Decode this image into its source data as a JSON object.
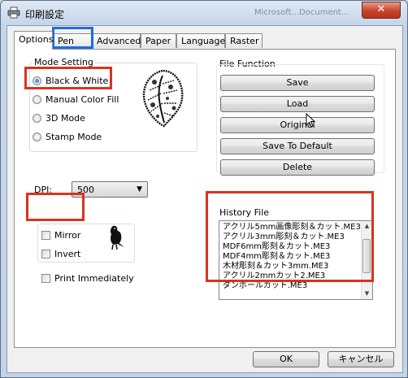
{
  "window": {
    "title": "印刷設定",
    "title_ghost": "Microsoft...Document...",
    "close_label": "✕"
  },
  "tabs": [
    {
      "label": "Options",
      "active": true
    },
    {
      "label": "Pen"
    },
    {
      "label": "Advanced"
    },
    {
      "label": "Paper"
    },
    {
      "label": "Language"
    },
    {
      "label": "Raster"
    }
  ],
  "mode": {
    "legend": "Mode Setting",
    "options": [
      {
        "label": "Black & White",
        "selected": true
      },
      {
        "label": "Manual Color Fill"
      },
      {
        "label": "3D Mode"
      },
      {
        "label": "Stamp Mode"
      }
    ]
  },
  "dpi": {
    "label": "DPI:",
    "value": "500"
  },
  "effects": {
    "mirror": "Mirror",
    "invert": "Invert",
    "print_immediately": "Print Immediately"
  },
  "file_function": {
    "legend": "File Function",
    "buttons": [
      "Save",
      "Load",
      "Original",
      "Save To Default",
      "Delete"
    ]
  },
  "history": {
    "legend": "History File",
    "items": [
      "アクリル5mm画像彫刻＆カット.ME3",
      "アクリル3mm彫刻＆カット.ME3",
      "MDF6mm彫刻＆カット.ME3",
      "MDF4mm彫刻＆カット.ME3",
      "木材彫刻＆カット3mm.ME3",
      "アクリル2mmカット2.ME3",
      "ダンボールカット.ME3"
    ]
  },
  "footer": {
    "ok": "OK",
    "cancel": "キャンセル"
  },
  "colors": {
    "highlight_red": "#d7341f",
    "highlight_blue": "#1e6be0"
  }
}
